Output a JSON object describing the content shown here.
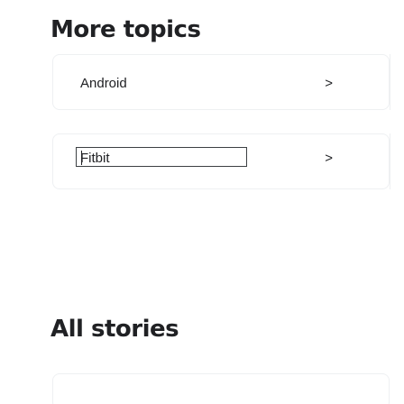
{
  "more_topics": {
    "heading": "More topics",
    "items": [
      {
        "label": "Android",
        "chevron": ">"
      },
      {
        "label": "Fitbit",
        "chevron": ">"
      }
    ]
  },
  "all_stories": {
    "heading": "All stories"
  }
}
